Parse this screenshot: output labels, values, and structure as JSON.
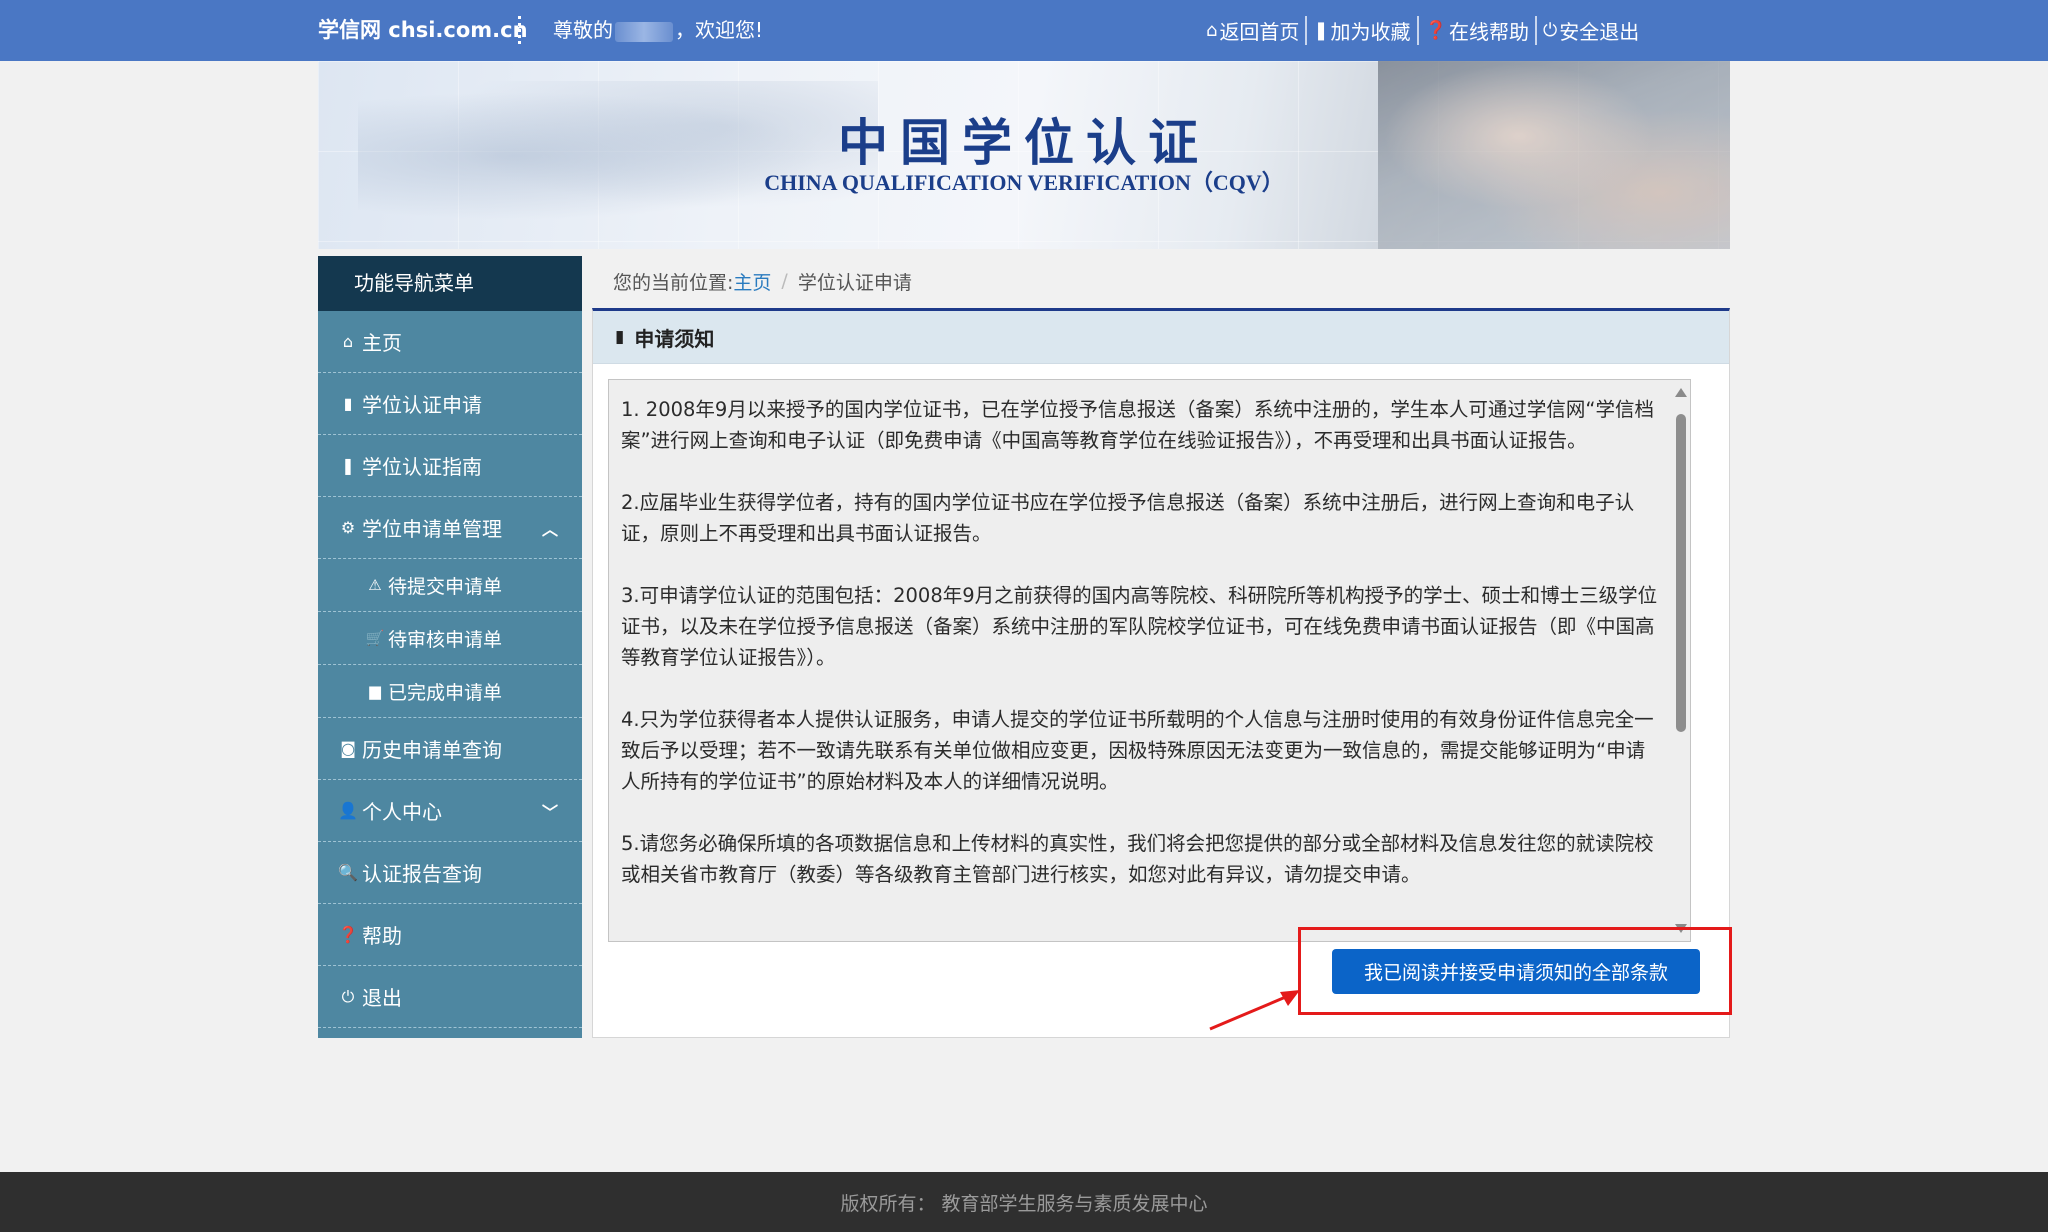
{
  "topbar": {
    "brand": "学信网 chsi.com.cn",
    "greeting_prefix": "尊敬的",
    "greeting_suffix": "，欢迎您!",
    "links": [
      {
        "icon": "home-icon",
        "label": "返回首页"
      },
      {
        "icon": "bookmark-icon",
        "label": "加为收藏"
      },
      {
        "icon": "help-icon",
        "label": "在线帮助"
      },
      {
        "icon": "power-icon",
        "label": "安全退出"
      }
    ]
  },
  "banner": {
    "title_cn": "中国学位认证",
    "title_en": "CHINA QUALIFICATION VERIFICATION（CQV）"
  },
  "sidebar": {
    "title": "功能导航菜单",
    "items": [
      {
        "icon": "home-icon",
        "label": "主页"
      },
      {
        "icon": "file-icon",
        "label": "学位认证申请"
      },
      {
        "icon": "bookmark-icon",
        "label": "学位认证指南"
      },
      {
        "icon": "gear-icon",
        "label": "学位申请单管理",
        "expanded": true
      },
      {
        "icon": "warning-icon",
        "label": "待提交申请单"
      },
      {
        "icon": "cart-icon",
        "label": "待审核申请单"
      },
      {
        "icon": "briefcase-icon",
        "label": "已完成申请单"
      },
      {
        "icon": "camera-icon",
        "label": "历史申请单查询"
      },
      {
        "icon": "user-icon",
        "label": "个人中心",
        "expanded": false
      },
      {
        "icon": "search-icon",
        "label": "认证报告查询"
      },
      {
        "icon": "help-icon",
        "label": "帮助"
      },
      {
        "icon": "power-icon",
        "label": "退出"
      }
    ]
  },
  "breadcrumb": {
    "prefix": "您的当前位置:",
    "home": "主页",
    "separator": "/",
    "current": "学位认证申请"
  },
  "panel": {
    "title": "申请须知",
    "paragraphs": [
      "1. 2008年9月以来授予的国内学位证书，已在学位授予信息报送（备案）系统中注册的，学生本人可通过学信网“学信档案”进行网上查询和电子认证（即免费申请《中国高等教育学位在线验证报告》），不再受理和出具书面认证报告。",
      "2.应届毕业生获得学位者，持有的国内学位证书应在学位授予信息报送（备案）系统中注册后，进行网上查询和电子认证，原则上不再受理和出具书面认证报告。",
      "3.可申请学位认证的范围包括：2008年9月之前获得的国内高等院校、科研院所等机构授予的学士、硕士和博士三级学位证书，以及未在学位授予信息报送（备案）系统中注册的军队院校学位证书，可在线免费申请书面认证报告（即《中国高等教育学位认证报告》）。",
      "4.只为学位获得者本人提供认证服务，申请人提交的学位证书所载明的个人信息与注册时使用的有效身份证件信息完全一致后予以受理；若不一致请先联系有关单位做相应变更，因极特殊原因无法变更为一致信息的，需提交能够证明为“申请人所持有的学位证书”的原始材料及本人的详细情况说明。",
      "5.请您务必确保所填的各项数据信息和上传材料的真实性，我们将会把您提供的部分或全部材料及信息发往您的就读院校或相关省市教育厅（教委）等各级教育主管部门进行核实，如您对此有异议，请勿提交申请。"
    ],
    "accept_button": "我已阅读并接受申请须知的全部条款"
  },
  "footer": {
    "text": "版权所有：  教育部学生服务与素质发展中心"
  },
  "colors": {
    "topbar": "#4a77c4",
    "sidebar": "#4e87a1",
    "sidebar_head": "#14384f",
    "accept_button": "#0b64c8",
    "highlight": "#e41a1a"
  }
}
